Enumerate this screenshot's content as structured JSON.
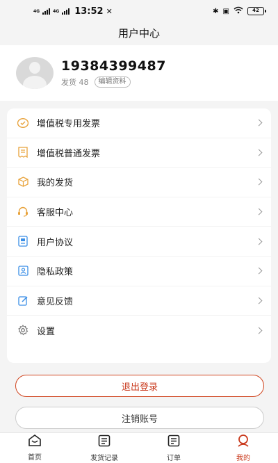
{
  "status_bar": {
    "network_1": "4G",
    "network_2": "4G",
    "time": "13:52",
    "battery": "42"
  },
  "title": "用户中心",
  "profile": {
    "phone": "19384399487",
    "shipments_text": "发货 48",
    "edit_label": "编辑资料"
  },
  "menu": {
    "items": [
      {
        "label": "增值税专用发票",
        "icon": "special-invoice-icon"
      },
      {
        "label": "增值税普通发票",
        "icon": "receipt-icon"
      },
      {
        "label": "我的发货",
        "icon": "box-icon"
      },
      {
        "label": "客服中心",
        "icon": "headset-icon"
      },
      {
        "label": "用户协议",
        "icon": "agreement-icon"
      },
      {
        "label": "隐私政策",
        "icon": "privacy-icon"
      },
      {
        "label": "意见反馈",
        "icon": "edit-feedback-icon"
      },
      {
        "label": "设置",
        "icon": "gear-icon"
      }
    ]
  },
  "buttons": {
    "logout": "退出登录",
    "cancel_account": "注销账号"
  },
  "tabbar": {
    "tabs": [
      {
        "label": "首页",
        "icon": "home-icon"
      },
      {
        "label": "发货记录",
        "icon": "document-icon"
      },
      {
        "label": "订单",
        "icon": "order-icon"
      },
      {
        "label": "我的",
        "icon": "profile-icon",
        "active": true
      }
    ]
  },
  "colors": {
    "accent": "#c9381b",
    "icon_orange": "#e8a23a",
    "icon_blue": "#3a8ee6",
    "background": "#f4f4f4"
  }
}
